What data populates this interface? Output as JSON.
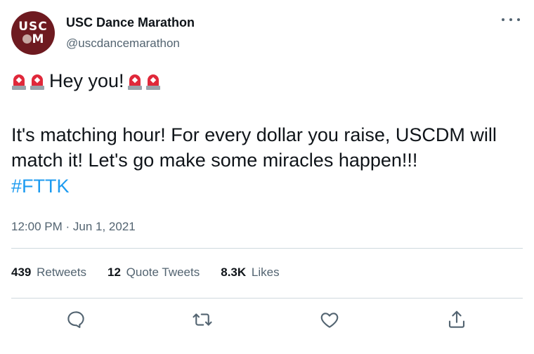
{
  "account": {
    "display_name": "USC Dance Marathon",
    "handle": "@uscdancemarathon",
    "avatar_text": "USC DM"
  },
  "tweet": {
    "emoji_name": "police-car-light",
    "headline": "Hey you!",
    "body": "It's matching hour! For every dollar you raise, USCDM will match it! Let's go make some miracles happen!!!",
    "hashtag": "#FTTK",
    "timestamp": "12:00 PM · Jun 1, 2021"
  },
  "stats": {
    "retweets_count": "439",
    "retweets_label": "Retweets",
    "quotes_count": "12",
    "quotes_label": "Quote Tweets",
    "likes_count": "8.3K",
    "likes_label": "Likes"
  },
  "colors": {
    "link": "#1d9bf0",
    "secondary_text": "#536471",
    "avatar_bg": "#6e1a20"
  }
}
